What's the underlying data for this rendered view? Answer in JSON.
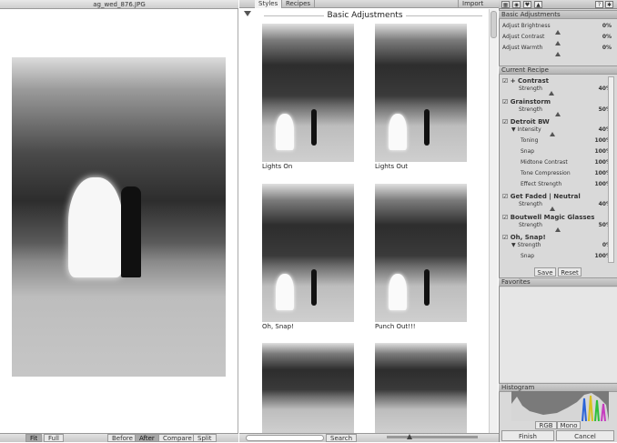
{
  "left_panel": {
    "filename": "ag_wed_876.JPG",
    "zoom_buttons": [
      "Fit",
      "Full"
    ],
    "compare_buttons": [
      "Before",
      "After",
      "Compare",
      "Split"
    ]
  },
  "middle_panel": {
    "tabs": [
      "Styles",
      "Recipes"
    ],
    "import_label": "Import",
    "group_title": "Basic Adjustments",
    "thumbnails": [
      "Lights On",
      "Lights Out",
      "Oh, Snap!",
      "Punch Out!!!",
      "",
      ""
    ],
    "search_button": "Search"
  },
  "right_panel": {
    "toolbar_icons": [
      "grid-icon",
      "camera-icon",
      "heart-icon",
      "mountain-icon",
      "help-icon",
      "settings-icon"
    ],
    "basic_adjustments": {
      "title": "Basic Adjustments",
      "rows": [
        {
          "label": "Adjust Brightness",
          "value": "0%"
        },
        {
          "label": "Adjust Contrast",
          "value": "0%"
        },
        {
          "label": "Adjust Warmth",
          "value": "0%"
        }
      ]
    },
    "current_recipe": {
      "title": "Current Recipe",
      "items": [
        {
          "name": "+ Contrast",
          "param": "Strength",
          "value": "40%"
        },
        {
          "name": "Grainstorm",
          "param": "Strength",
          "value": "50%"
        },
        {
          "name": "Detroit BW",
          "param": "Intensity",
          "value": "40%"
        },
        {
          "name": "",
          "param": "Toning",
          "value": "100%"
        },
        {
          "name": "",
          "param": "Snap",
          "value": "100%"
        },
        {
          "name": "",
          "param": "Midtone Contrast",
          "value": "100%"
        },
        {
          "name": "",
          "param": "Tone Compression",
          "value": "100%"
        },
        {
          "name": "",
          "param": "Effect Strength",
          "value": "100%"
        },
        {
          "name": "Get Faded | Neutral",
          "param": "Strength",
          "value": "40%"
        },
        {
          "name": "Boutwell Magic Glasses",
          "param": "Strength",
          "value": "50%"
        },
        {
          "name": "Oh, Snap!",
          "param": "Strength",
          "value": "0%"
        },
        {
          "name": "",
          "param": "Snap",
          "value": "100%"
        }
      ],
      "save_button": "Save",
      "reset_button": "Reset"
    },
    "favorites_title": "Favorites",
    "histogram": {
      "title": "Histogram",
      "modes": [
        "RGB",
        "Mono"
      ]
    },
    "finish_button": "Finish",
    "cancel_button": "Cancel"
  }
}
